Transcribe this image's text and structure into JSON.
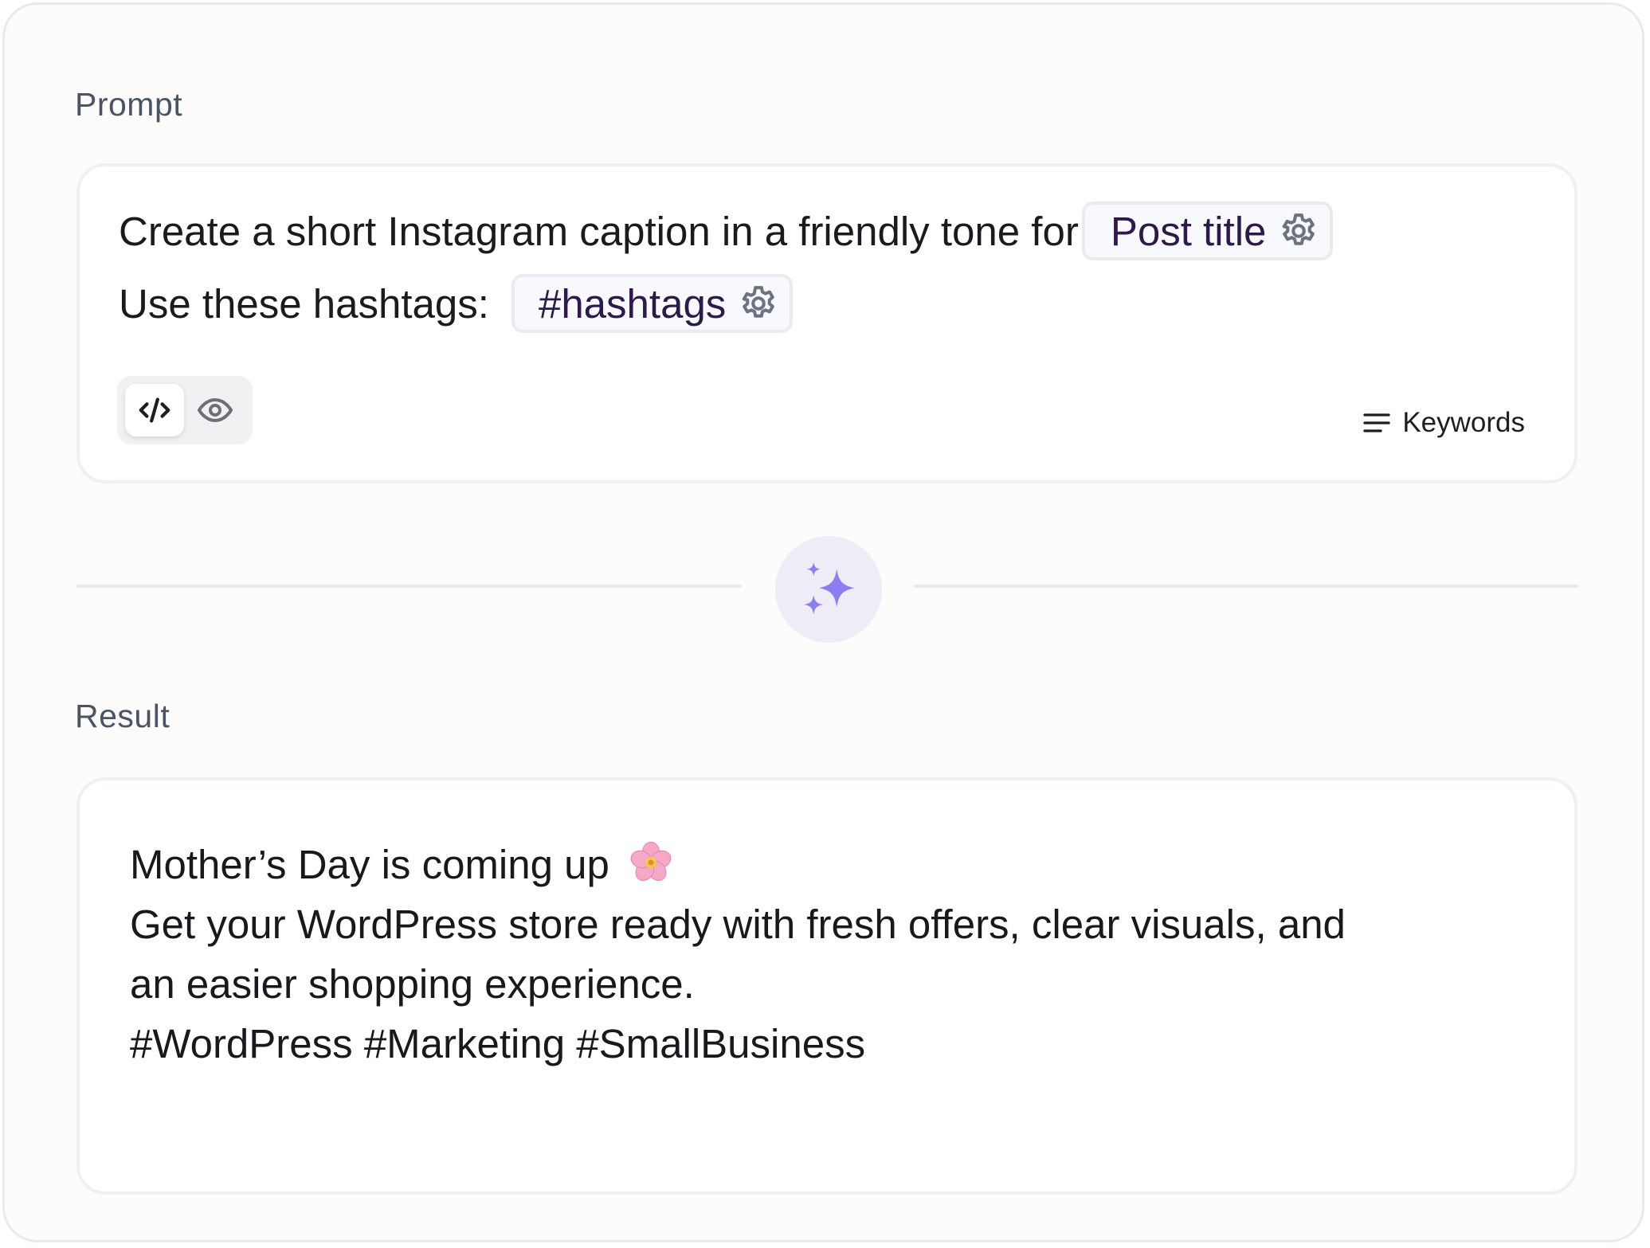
{
  "prompt": {
    "label": "Prompt",
    "line1_text": "Create a short Instagram caption in a friendly tone for",
    "line2_text": "Use these hashtags:",
    "chips": {
      "post_title": "Post title",
      "hashtags": "#hashtags"
    },
    "keywords_label": "Keywords",
    "mode_toggle": {
      "selected": "code",
      "options": [
        "code-icon",
        "eye-icon"
      ]
    }
  },
  "result": {
    "label": "Result",
    "line1": "Mother’s Day is coming up",
    "line2": "Get your WordPress store ready with fresh offers, clear visuals, and",
    "line3": "an easier shopping experience.",
    "line4": "#WordPress #Marketing #SmallBusiness"
  },
  "colors": {
    "accent": "#8a7ef0",
    "chip_text": "#2d1a4a",
    "card_bg": "#fdfcfa",
    "sparkle_bg": "#efecf8"
  }
}
